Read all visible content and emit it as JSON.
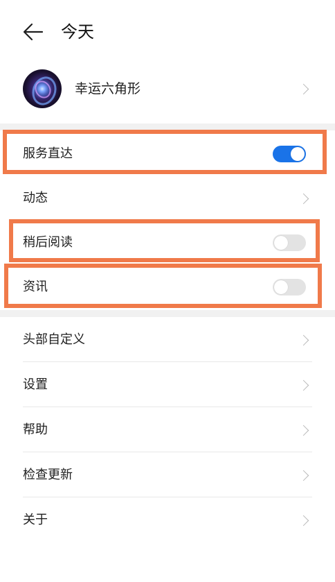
{
  "header": {
    "title": "今天"
  },
  "profile": {
    "name": "幸运六角形"
  },
  "settings": [
    {
      "label": "服务直达",
      "type": "toggle",
      "on": true
    },
    {
      "label": "动态",
      "type": "link"
    },
    {
      "label": "稍后阅读",
      "type": "toggle",
      "on": false
    },
    {
      "label": "资讯",
      "type": "toggle",
      "on": false
    }
  ],
  "menu": [
    {
      "label": "头部自定义"
    },
    {
      "label": "设置"
    },
    {
      "label": "帮助"
    },
    {
      "label": "检查更新"
    },
    {
      "label": "关于"
    }
  ],
  "colors": {
    "highlight": "#f07a4a",
    "toggle_on": "#1a73e8",
    "toggle_off": "#e3e3e3"
  }
}
